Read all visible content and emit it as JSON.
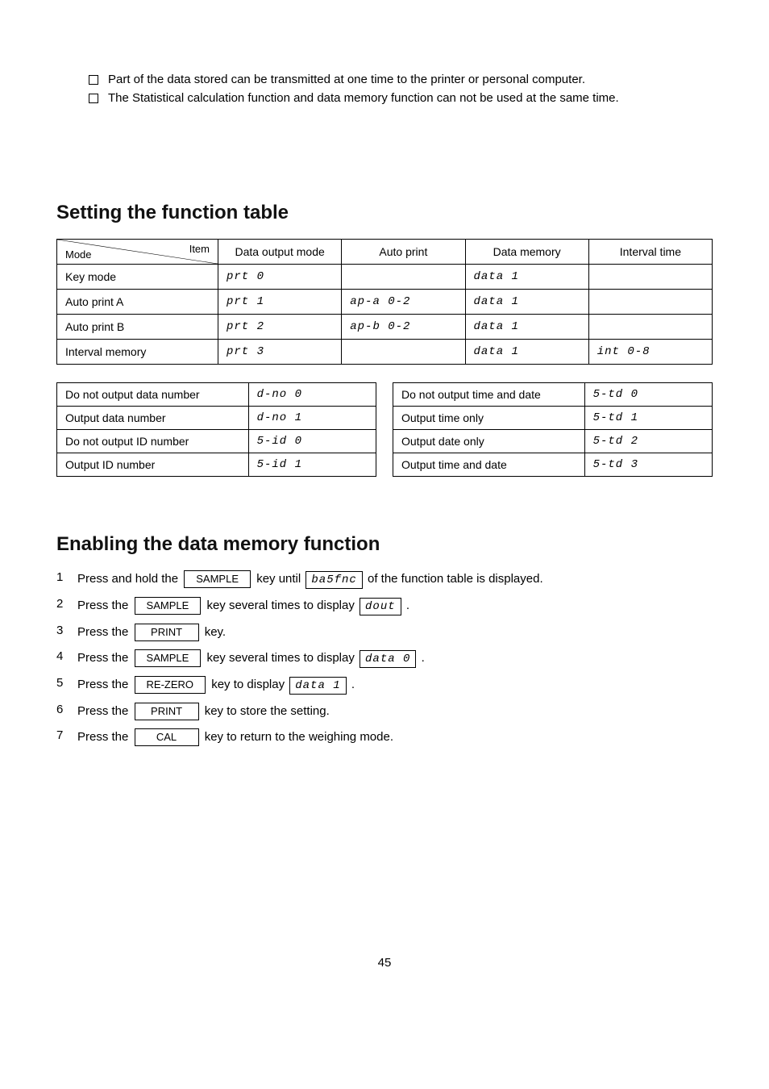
{
  "bullets": [
    "Part of the data stored can be transmitted at one time to the printer or personal computer.",
    "The Statistical calculation function and data memory function can not be used at the same time."
  ],
  "sec1_title": "Setting the function table",
  "fn_head": {
    "diag_top": "Item",
    "diag_bot": "Mode",
    "c1": "Data output mode",
    "c2": "Auto print",
    "c3": "Data memory",
    "c4": "Interval time"
  },
  "fn_rows": [
    {
      "mode": "Key mode",
      "c1": "prt 0",
      "c2": "",
      "c3": "data 1",
      "c4": ""
    },
    {
      "mode": "Auto print A",
      "c1": "prt 1",
      "c2": "ap-a 0-2",
      "c3": "data 1",
      "c4": ""
    },
    {
      "mode": "Auto print B",
      "c1": "prt 2",
      "c2": "ap-b 0-2",
      "c3": "data 1",
      "c4": ""
    },
    {
      "mode": "Interval memory",
      "c1": "prt 3",
      "c2": "",
      "c3": "data 1",
      "c4": "int 0-8"
    }
  ],
  "left_small": [
    {
      "l": "Do not output data number",
      "v": "d-no 0"
    },
    {
      "l": "Output data number",
      "v": "d-no 1"
    },
    {
      "l": "Do not output ID number",
      "v": "5-id 0"
    },
    {
      "l": "Output ID number",
      "v": "5-id 1"
    }
  ],
  "right_small": [
    {
      "l": "Do not output time and date",
      "v": "5-td 0"
    },
    {
      "l": "Output time only",
      "v": "5-td 1"
    },
    {
      "l": "Output date only",
      "v": "5-td 2"
    },
    {
      "l": "Output time and date",
      "v": "5-td 3"
    }
  ],
  "sec2_title": "Enabling the data memory function",
  "steps": [
    {
      "n": "1",
      "pre": "Press and hold the ",
      "key": "SAMPLE",
      "post": " key until ",
      "seg": "ba5fnc",
      "tail": " of the function table is displayed."
    },
    {
      "n": "2",
      "pre": "Press the ",
      "key": "SAMPLE",
      "post": " key several times to display ",
      "seg": "dout",
      "tail": " ."
    },
    {
      "n": "3",
      "pre": "Press the ",
      "key": "PRINT",
      "post": " key.",
      "seg": "",
      "tail": ""
    },
    {
      "n": "4",
      "pre": "Press the ",
      "key": "SAMPLE",
      "post": " key several times to display ",
      "seg": "data 0",
      "tail": " ."
    },
    {
      "n": "5",
      "pre": "Press the ",
      "key": "RE-ZERO",
      "post": " key to display ",
      "seg": "data 1",
      "tail": " ."
    },
    {
      "n": "6",
      "pre": "Press the ",
      "key": "PRINT",
      "post": " key to store the setting.",
      "seg": "",
      "tail": ""
    },
    {
      "n": "7",
      "pre": "Press the ",
      "key": "CAL",
      "post": " key to return to the weighing mode.",
      "seg": "",
      "tail": ""
    }
  ],
  "page_num": "45"
}
